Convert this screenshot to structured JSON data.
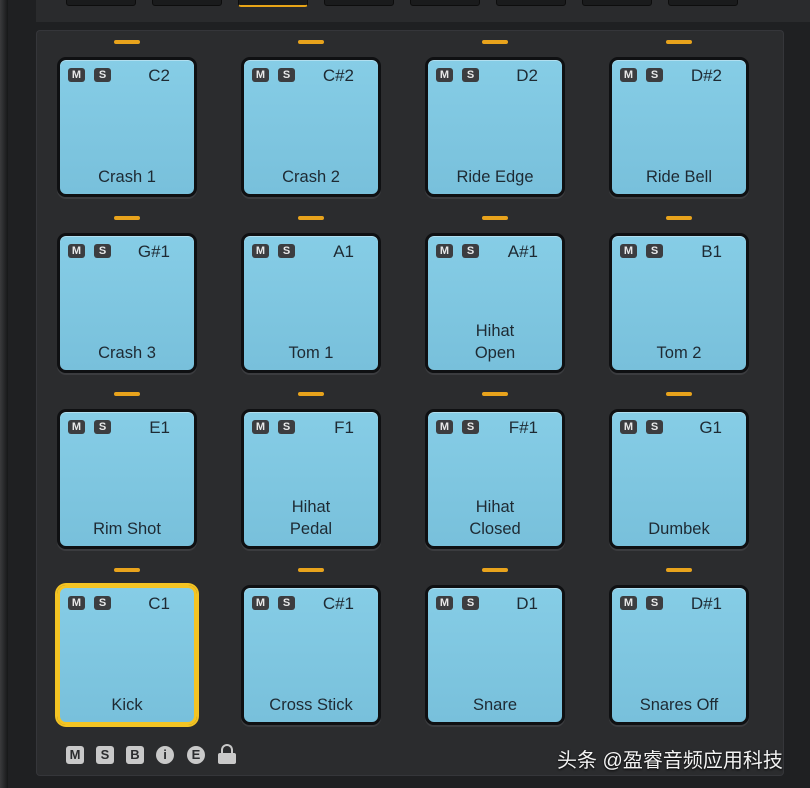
{
  "pads": [
    {
      "note": "C2",
      "name": "Crash 1",
      "mute": "M",
      "solo": "S"
    },
    {
      "note": "C#2",
      "name": "Crash 2",
      "mute": "M",
      "solo": "S"
    },
    {
      "note": "D2",
      "name": "Ride Edge",
      "mute": "M",
      "solo": "S"
    },
    {
      "note": "D#2",
      "name": "Ride Bell",
      "mute": "M",
      "solo": "S"
    },
    {
      "note": "G#1",
      "name": "Crash 3",
      "mute": "M",
      "solo": "S"
    },
    {
      "note": "A1",
      "name": "Tom 1",
      "mute": "M",
      "solo": "S"
    },
    {
      "note": "A#1",
      "name": "Hihat\nOpen",
      "mute": "M",
      "solo": "S"
    },
    {
      "note": "B1",
      "name": "Tom 2",
      "mute": "M",
      "solo": "S"
    },
    {
      "note": "E1",
      "name": "Rim Shot",
      "mute": "M",
      "solo": "S"
    },
    {
      "note": "F1",
      "name": "Hihat\nPedal",
      "mute": "M",
      "solo": "S"
    },
    {
      "note": "F#1",
      "name": "Hihat\nClosed",
      "mute": "M",
      "solo": "S"
    },
    {
      "note": "G1",
      "name": "Dumbek",
      "mute": "M",
      "solo": "S"
    },
    {
      "note": "C1",
      "name": "Kick",
      "mute": "M",
      "solo": "S",
      "selected": true
    },
    {
      "note": "C#1",
      "name": "Cross Stick",
      "mute": "M",
      "solo": "S"
    },
    {
      "note": "D1",
      "name": "Snare",
      "mute": "M",
      "solo": "S"
    },
    {
      "note": "D#1",
      "name": "Snares Off",
      "mute": "M",
      "solo": "S"
    }
  ],
  "footer": {
    "mute_all": "M",
    "solo_all": "S",
    "b_button": "B",
    "info_button": "i",
    "e_button": "E",
    "lock_icon": "lock-icon"
  },
  "watermark": "头条 @盈睿音频应用科技",
  "colors": {
    "pad": "#7cc5df",
    "led": "#e8a31c",
    "selected": "#f4c423",
    "panel": "#2b2c2e"
  }
}
